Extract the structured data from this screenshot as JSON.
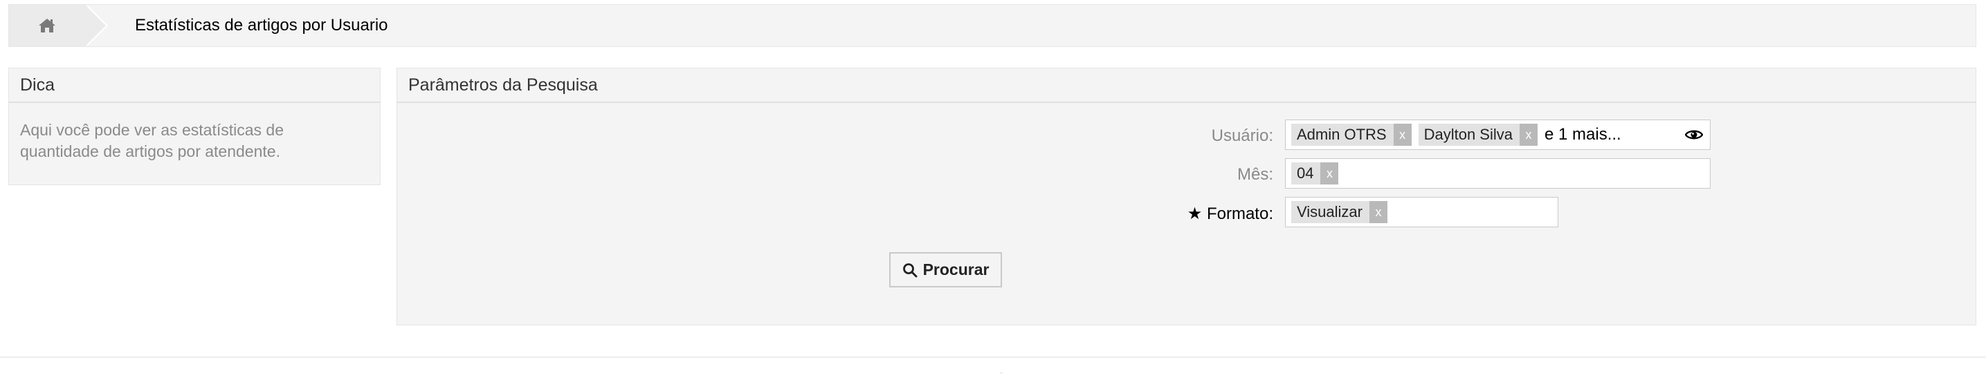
{
  "breadcrumb": {
    "home_icon": "home-icon",
    "title": "Estatísticas de artigos por Usuario"
  },
  "hint": {
    "title": "Dica",
    "text": "Aqui você pode ver as estatísticas de quantidade de artigos por atendente."
  },
  "search": {
    "title": "Parâmetros da Pesquisa",
    "user": {
      "label": "Usuário:",
      "chips": [
        "Admin OTRS",
        "Daylton Silva"
      ],
      "more": "e 1 mais...",
      "eye_icon": "eye-icon"
    },
    "month": {
      "label": "Mês:",
      "chips": [
        "04"
      ]
    },
    "format": {
      "label": "★ Formato:",
      "chips": [
        "Visualizar"
      ]
    },
    "chip_remove": "x",
    "button_label": "Procurar",
    "button_icon": "search-icon"
  },
  "footer": {
    "mark": "¨"
  }
}
